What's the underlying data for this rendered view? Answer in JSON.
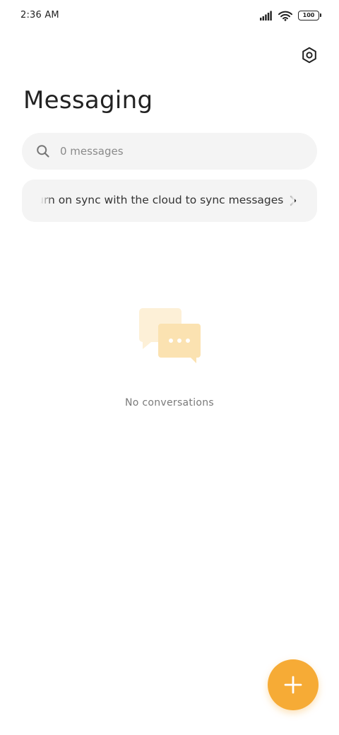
{
  "status_bar": {
    "time": "2:36 AM",
    "battery_level": "100",
    "icons": [
      "signal-icon",
      "wifi-icon",
      "battery-icon"
    ]
  },
  "header": {
    "title": "Messaging",
    "settings_icon": "settings-icon"
  },
  "search": {
    "placeholder": "0 messages",
    "icon": "search-icon"
  },
  "sync_banner": {
    "text": "Turn on sync with the cloud to sync messages",
    "icon": "chevron-right-icon"
  },
  "empty_state": {
    "icon": "chat-bubbles-icon",
    "text": "No conversations"
  },
  "fab": {
    "icon": "plus-icon"
  },
  "colors": {
    "accent": "#f6ab36",
    "illustration_light": "#fdf0d7",
    "illustration_mid": "#fbe2b1",
    "surface": "#f4f4f4",
    "text_primary": "#222222",
    "text_secondary": "#7a7a7a"
  }
}
